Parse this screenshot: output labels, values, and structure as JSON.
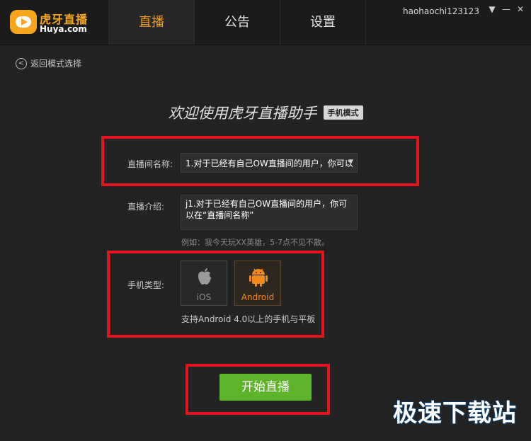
{
  "app": {
    "logo_cn": "虎牙直播",
    "logo_en": "Huya.com",
    "username": "haohaochi123123"
  },
  "nav": {
    "tabs": [
      {
        "label": "直播",
        "active": true
      },
      {
        "label": "公告",
        "active": false
      },
      {
        "label": "设置",
        "active": false
      }
    ]
  },
  "window_buttons": {
    "dropdown": "▼",
    "minimize": "—",
    "close": "✕"
  },
  "back": {
    "label": "返回模式选择"
  },
  "welcome": {
    "title": "欢迎使用虎牙直播助手",
    "mode_badge": "手机模式"
  },
  "form": {
    "room_name_label": "直播间名称:",
    "room_name_value": "1.对于已经有自己OW直播间的用户，你可以",
    "intro_label": "直播介绍:",
    "intro_value": "j1.对于已经有自己OW直播间的用户，你可以在“直播间名称”",
    "intro_hint": "例如：我今天玩XX英雄，5-7点不见不散。",
    "phone_type_label": "手机类型:",
    "phone_options": [
      {
        "label": "iOS",
        "icon": "apple-icon",
        "selected": false
      },
      {
        "label": "Android",
        "icon": "android-icon",
        "selected": true
      }
    ],
    "support_text": "支持Android 4.0以上的手机与平板"
  },
  "start_button": {
    "label": "开始直播"
  },
  "watermark": {
    "text": "极速下载站"
  },
  "colors": {
    "accent_orange": "#f39c1d",
    "start_green": "#5eb52a",
    "highlight_red": "#e3141d",
    "background": "#232323"
  }
}
